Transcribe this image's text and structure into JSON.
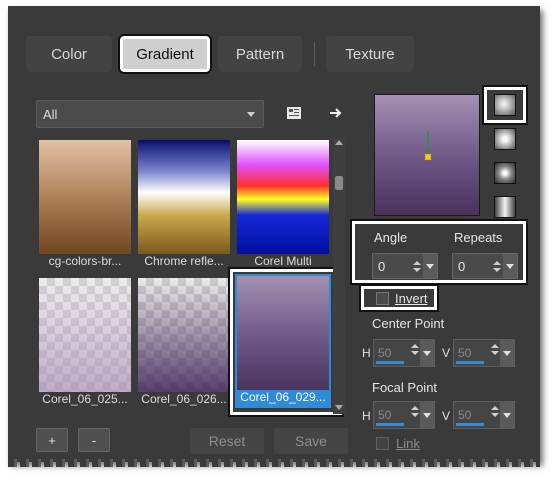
{
  "tabs": {
    "color": "Color",
    "gradient": "Gradient",
    "pattern": "Pattern",
    "texture": "Texture",
    "active": "gradient"
  },
  "library": {
    "dropdown_value": "All",
    "swatches": [
      {
        "label": "cg-colors-br...",
        "selected": false
      },
      {
        "label": "Chrome refle...",
        "selected": false
      },
      {
        "label": "Corel Multi",
        "selected": false
      },
      {
        "label": "Corel_06_025...",
        "selected": false
      },
      {
        "label": "Corel_06_026...",
        "selected": false
      },
      {
        "label": "Corel_06_029...",
        "selected": true
      }
    ]
  },
  "buttons": {
    "add": "+",
    "remove": "-",
    "reset": "Reset",
    "save": "Save"
  },
  "settings": {
    "angle_label": "Angle",
    "angle_value": "0",
    "repeats_label": "Repeats",
    "repeats_value": "0",
    "invert_label": "Invert",
    "invert_checked": false,
    "center_point_label": "Center Point",
    "center_h": "50",
    "center_v": "50",
    "focal_point_label": "Focal Point",
    "focal_h": "50",
    "focal_v": "50",
    "h_label": "H",
    "v_label": "V",
    "link_label": "Link",
    "link_checked": false
  },
  "colors": {
    "panel_bg": "#3a3a3a",
    "selection": "#2f8bd8",
    "slider_fill": "#3a8ad6"
  }
}
